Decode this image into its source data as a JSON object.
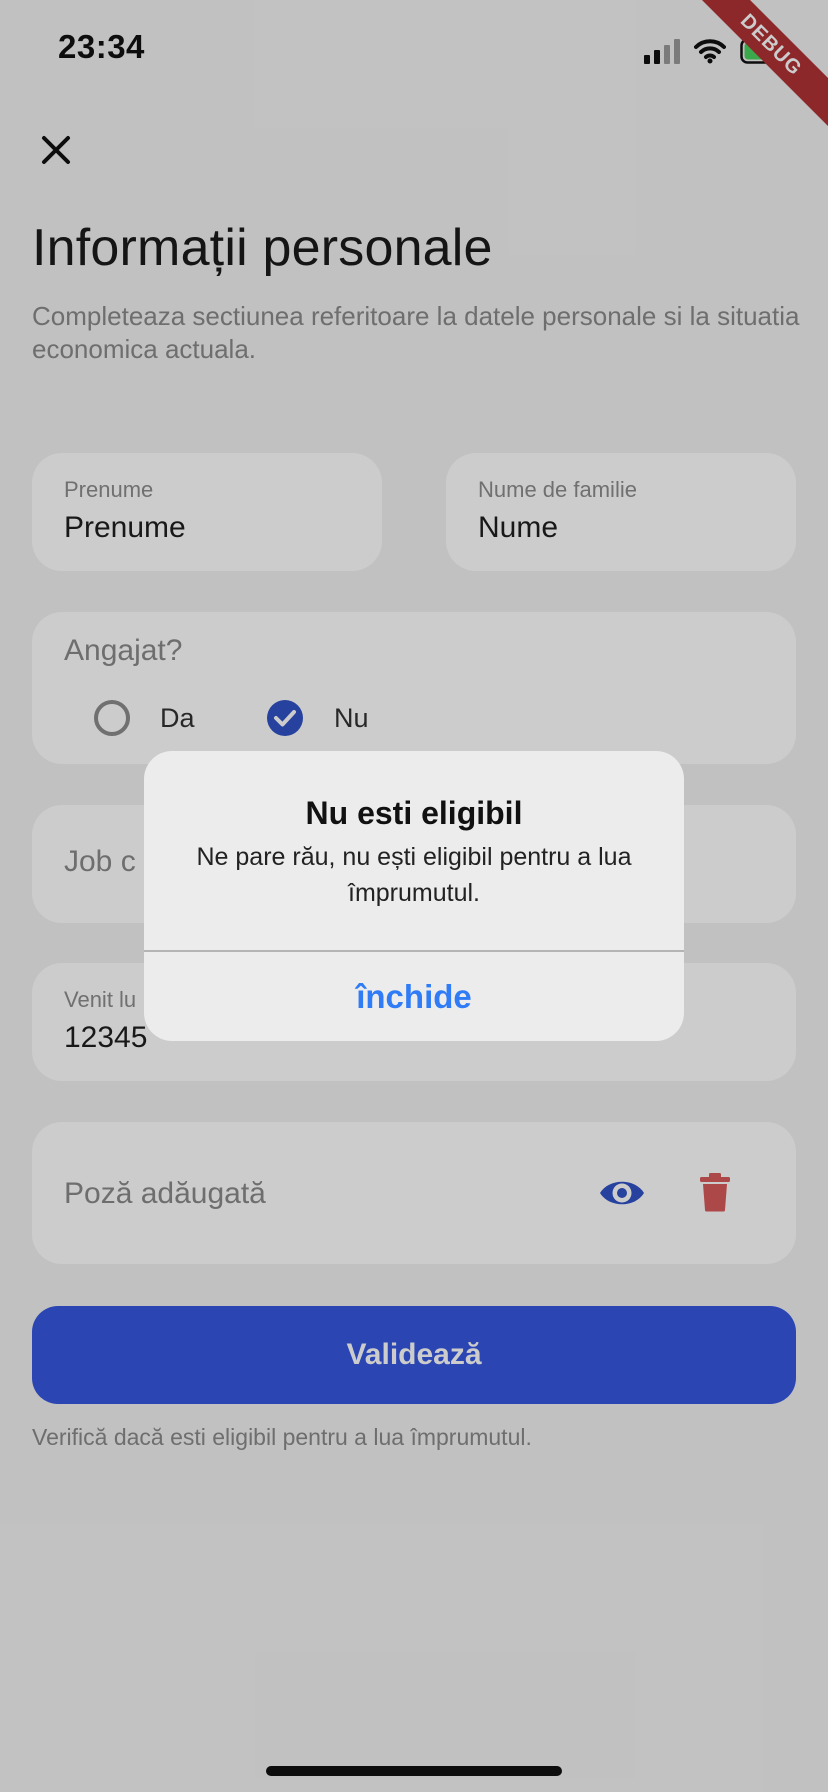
{
  "status_bar": {
    "time": "23:34",
    "debug_label": "DEBUG"
  },
  "header": {
    "title": "Informații personale",
    "subtitle": "Completeaza sectiunea referitoare la datele personale si la situatia economica actuala."
  },
  "form": {
    "first_name": {
      "label": "Prenume",
      "value": "Prenume"
    },
    "last_name": {
      "label": "Nume de familie",
      "value": "Nume"
    },
    "employed": {
      "question": "Angajat?",
      "options": [
        {
          "label": "Da",
          "selected": false
        },
        {
          "label": "Nu",
          "selected": true
        }
      ]
    },
    "job_field": {
      "placeholder": "Job c"
    },
    "income": {
      "label": "Venit lu",
      "value": "12345"
    },
    "photo": {
      "label": "Poză adăugată",
      "view_icon": "eye-icon",
      "delete_icon": "trash-icon"
    }
  },
  "validate_button": "Validează",
  "helper_text": "Verifică dacă esti eligibil pentru a lua împrumutul.",
  "dialog": {
    "title": "Nu esti eligibil",
    "message": "Ne pare rău, nu ești eligibil pentru a lua împrumutul.",
    "action": "închide"
  },
  "colors": {
    "accent": "#3658e0",
    "radio_selected": "#3052c6",
    "delete": "#d95a5a",
    "dialog_action": "#2f7cf6"
  }
}
